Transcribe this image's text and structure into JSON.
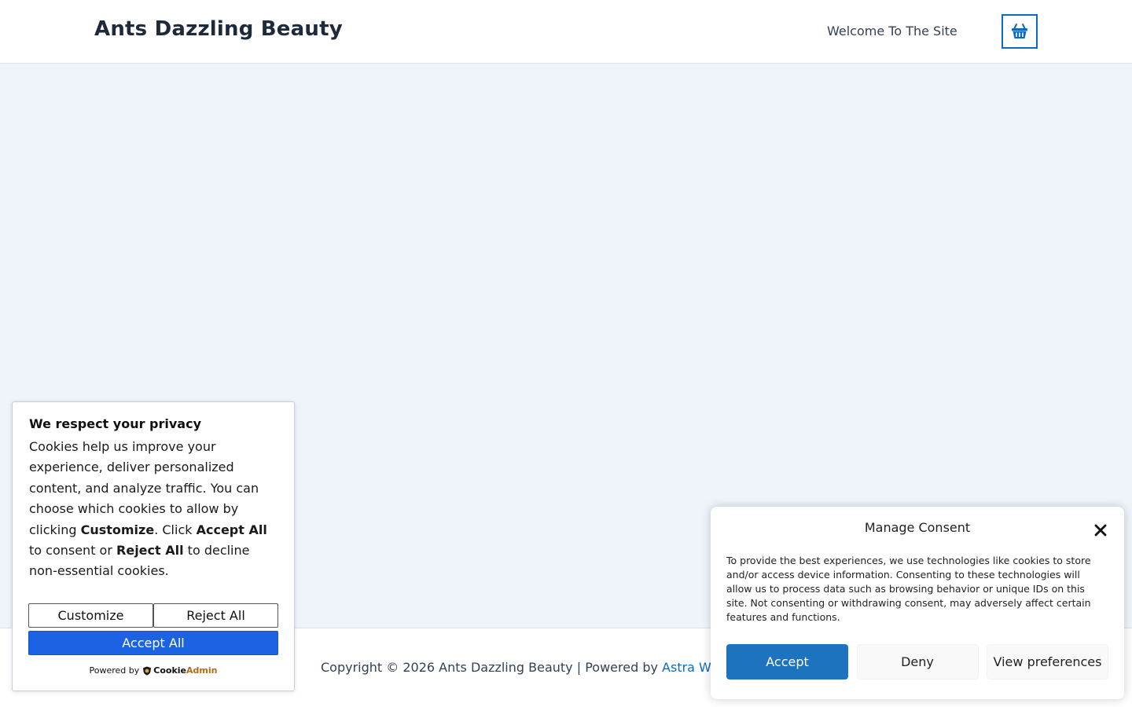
{
  "header": {
    "site_title": "Ants Dazzling Beauty",
    "nav_welcome": "Welcome To The Site",
    "cart_icon": "shopping-basket-icon"
  },
  "footer": {
    "copyright": "Copyright © 2026 Ants Dazzling Beauty | Powered by ",
    "link_text": "Astra W"
  },
  "privacy_notice": {
    "title": "We respect your privacy",
    "text_1": "Cookies help us improve your experience, deliver personalized content, and analyze traffic. You can choose which cookies to allow by clicking ",
    "bold_customize": "Customize",
    "text_2": ". Click ",
    "bold_accept_all": "Accept All",
    "text_3": " to consent or ",
    "bold_reject_all": "Reject All",
    "text_4": " to decline non-essential cookies.",
    "customize_label": "Customize",
    "reject_all_label": "Reject All",
    "accept_all_label": "Accept All",
    "powered_by_label": "Powered by",
    "brand_cookie": "Cookie",
    "brand_admin": "Admin"
  },
  "consent_dialog": {
    "title": "Manage Consent",
    "body": "To provide the best experiences, we use technologies like cookies to store and/or access device information. Consenting to these technologies will allow us to process data such as browsing behavior or unique IDs on this site. Not consenting or withdrawing consent, may adversely affect certain features and functions.",
    "accept_label": "Accept",
    "deny_label": "Deny",
    "view_preferences_label": "View preferences"
  },
  "colors": {
    "accent": "#0b6ac1",
    "accept_all_blue": "#1c63e3",
    "consent_accept_blue": "#1e73be",
    "page_background": "#eff4fa"
  }
}
